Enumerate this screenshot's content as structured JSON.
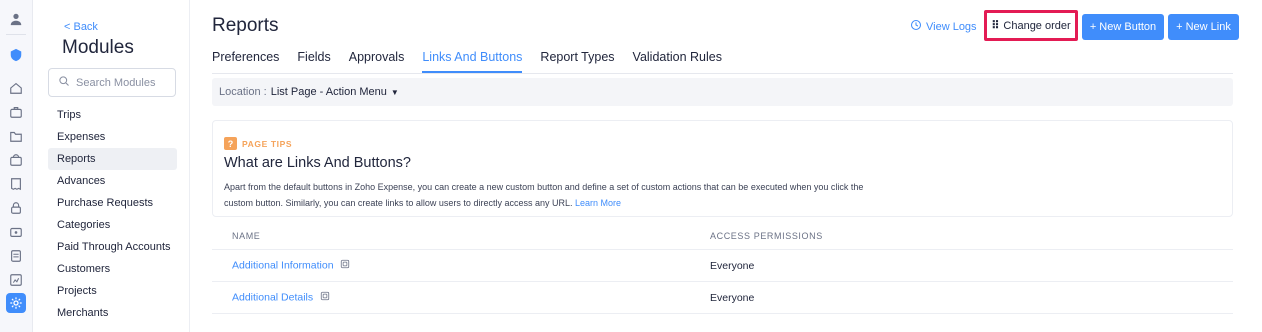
{
  "rail": {
    "items": [
      {
        "icon": "user-avatar-icon"
      },
      {
        "icon": "shield-badge-icon"
      },
      {
        "icon": "home-icon"
      },
      {
        "icon": "briefcase-icon"
      },
      {
        "icon": "folder-icon"
      },
      {
        "icon": "bag-icon"
      },
      {
        "icon": "receipt-icon"
      },
      {
        "icon": "lock-icon"
      },
      {
        "icon": "card-icon"
      },
      {
        "icon": "document-icon"
      },
      {
        "icon": "chart-icon"
      },
      {
        "icon": "settings-icon"
      }
    ]
  },
  "sidebar": {
    "back_label": "< Back",
    "title": "Modules",
    "search_placeholder": "Search Modules",
    "items": [
      {
        "label": "Trips"
      },
      {
        "label": "Expenses"
      },
      {
        "label": "Reports"
      },
      {
        "label": "Advances"
      },
      {
        "label": "Purchase Requests"
      },
      {
        "label": "Categories"
      },
      {
        "label": "Paid Through Accounts"
      },
      {
        "label": "Customers"
      },
      {
        "label": "Projects"
      },
      {
        "label": "Merchants"
      }
    ],
    "active_item": "Reports"
  },
  "header": {
    "title": "Reports",
    "view_logs": "View Logs",
    "change_order": "Change order",
    "new_button": "+ New Button",
    "new_link": "+ New Link"
  },
  "tabs": [
    {
      "label": "Preferences"
    },
    {
      "label": "Fields"
    },
    {
      "label": "Approvals"
    },
    {
      "label": "Links And Buttons"
    },
    {
      "label": "Report Types"
    },
    {
      "label": "Validation Rules"
    }
  ],
  "active_tab": "Links And Buttons",
  "location": {
    "label": "Location :",
    "value": "List Page - Action Menu"
  },
  "tips": {
    "badge": "?",
    "label": "PAGE TIPS",
    "title": "What are Links And Buttons?",
    "body_line1": "Apart from the default buttons in Zoho Expense, you can create a new custom button and define a set of custom actions that can be executed when you click the",
    "body_line2": "custom button. Similarly, you can create links to allow users to directly access any URL.",
    "learn_more": "Learn More"
  },
  "table": {
    "columns": [
      "NAME",
      "ACCESS PERMISSIONS"
    ],
    "rows": [
      {
        "name": "Additional Information",
        "access": "Everyone"
      },
      {
        "name": "Additional Details",
        "access": "Everyone"
      }
    ]
  },
  "colors": {
    "accent": "#408dfb",
    "highlight_border": "#e31b54",
    "tips_orange": "#f5a35a"
  }
}
